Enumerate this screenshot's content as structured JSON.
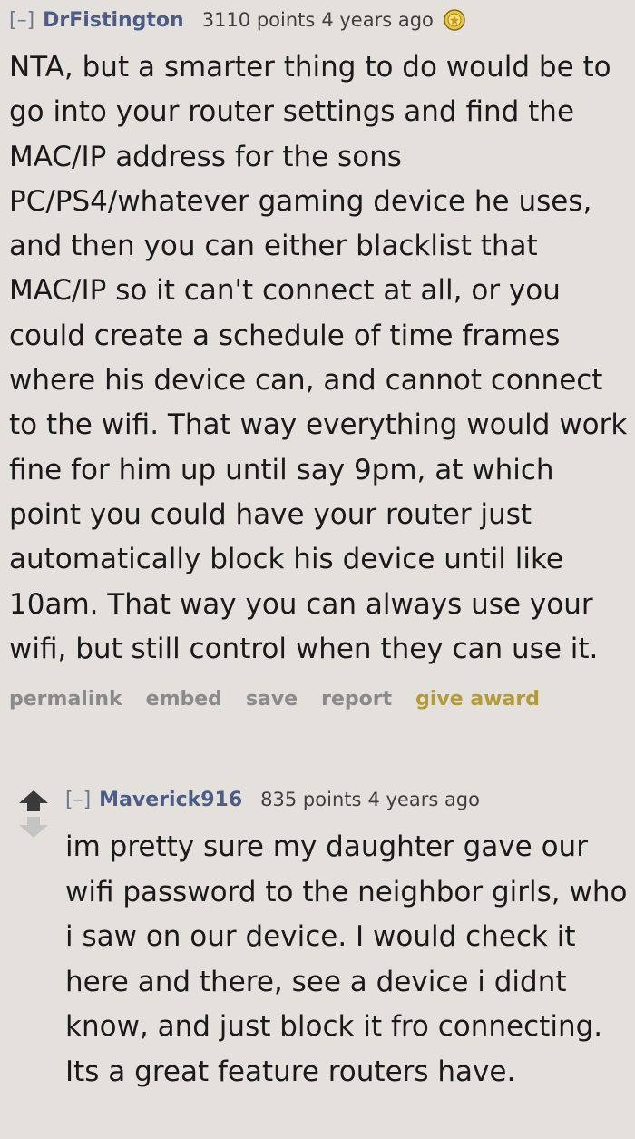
{
  "comments": [
    {
      "collapse_label": "[–]",
      "author": "DrFistington",
      "score": "3110 points",
      "time": "4 years ago",
      "award_icon": "award-badge-icon",
      "body": "NTA, but a smarter thing to do would be to go into your router settings and find the MAC/IP address for the sons PC/PS4/whatever gaming device he uses, and then you can either blacklist that MAC/IP so it can't connect at all, or you could create a schedule of time frames where his device can, and cannot connect to the wifi. That way everything would work fine for him up until say 9pm, at which point you could have your router just automatically block his device until like 10am. That way you can always use your wifi, but still control when they can use it.",
      "buttons": {
        "permalink": "permalink",
        "embed": "embed",
        "save": "save",
        "report": "report",
        "give_award": "give award"
      }
    },
    {
      "collapse_label": "[–]",
      "author": "Maverick916",
      "score": "835 points",
      "time": "4 years ago",
      "body": "im pretty sure my daughter gave our wifi password to the neighbor girls, who i saw on our device. I would check it here and there, see a device i didnt know, and just block it fro connecting. Its a great feature routers have."
    }
  ],
  "icons": {
    "upvote": "upvote-arrow-icon",
    "downvote": "downvote-arrow-icon"
  },
  "colors": {
    "background": "#e4e1dc",
    "author": "#4d5c86",
    "give_award": "#b39a3a",
    "upvote": "#3a3a3a",
    "downvote": "#c4c4c4"
  }
}
